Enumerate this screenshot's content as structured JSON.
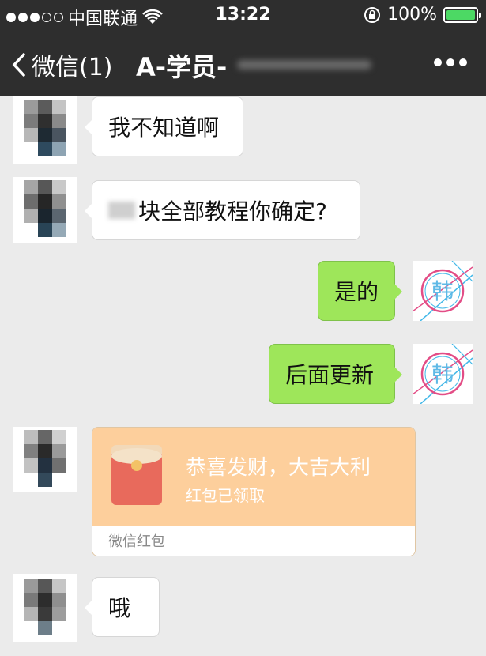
{
  "status_bar": {
    "carrier": "中国联通",
    "time": "13:22",
    "battery": "100%",
    "signal_dots_filled": 3,
    "signal_dots_total": 5,
    "battery_level": 1.0,
    "icons": [
      "wifi-icon",
      "orientation-lock-icon",
      "battery-icon"
    ]
  },
  "nav": {
    "back_label": "微信(1)",
    "title": "A-学员-",
    "more_icon": "more-icon"
  },
  "messages": [
    {
      "side": "left",
      "text": "我不知道啊"
    },
    {
      "side": "left",
      "text": "块全部教程你确定?"
    },
    {
      "side": "right",
      "text": "是的",
      "avatar_text": "韩"
    },
    {
      "side": "right",
      "text": "后面更新",
      "avatar_text": "韩"
    },
    {
      "side": "left",
      "type": "red_packet",
      "title": "恭喜发财，大吉大利",
      "subtitle": "红包已领取",
      "footer": "微信红包"
    },
    {
      "side": "left",
      "text": "哦"
    }
  ],
  "colors": {
    "nav_bg": "#2e2e2e",
    "chat_bg": "#ebebeb",
    "bubble_right": "#9ee65a",
    "red_packet": "#fdcf9c",
    "battery_fill": "#4cd964"
  }
}
